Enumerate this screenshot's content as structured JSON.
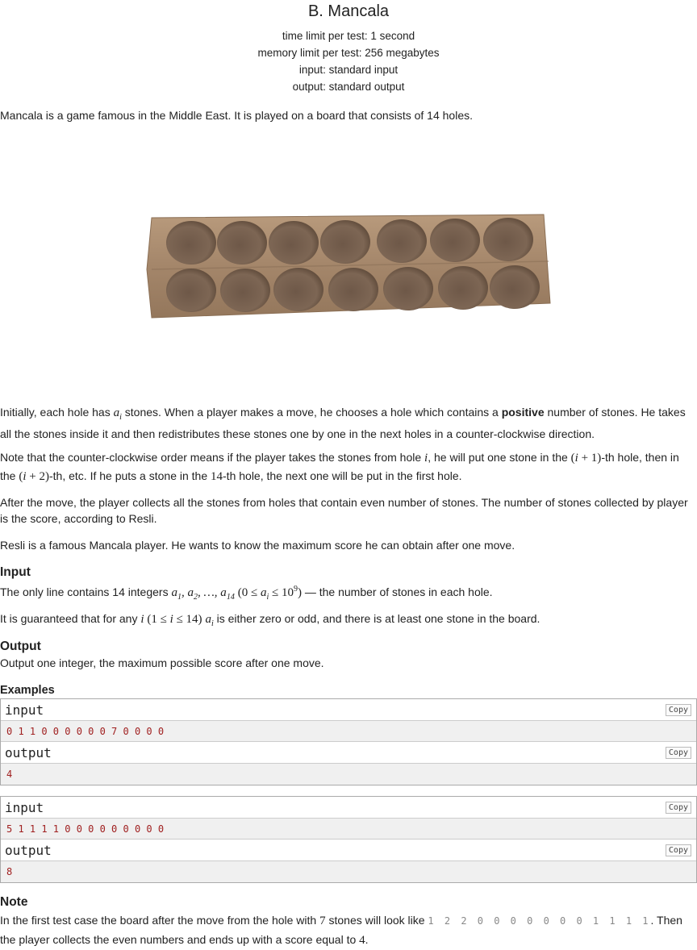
{
  "problem": {
    "title": "B. Mancala",
    "time_limit": "time limit per test: 1 second",
    "memory_limit": "memory limit per test: 256 megabytes",
    "input": "input: standard input",
    "output": "output: standard output"
  },
  "statement": {
    "intro": "Mancala is a game famous in the Middle East. It is played on a board that consists of 14 holes.",
    "p1_a": "Initially, each hole has ",
    "p1_b": " stones. When a player makes a move, he chooses a hole which contains a ",
    "p1_bold": "positive",
    "p1_c": " number of stones. He takes all the stones inside it and then redistributes these stones one by one in the next holes in a counter-clockwise direction.",
    "p2_a": "Note that the counter-clockwise order means if the player takes the stones from hole ",
    "p2_b": ", he will put one stone in the ",
    "p2_c": "-th hole, then in the ",
    "p2_d": "-th, etc. If he puts a stone in the ",
    "p2_e": "-th hole, the next one will be put in the first hole.",
    "p3": "After the move, the player collects all the stones from holes that contain even number of stones. The number of stones collected by player is the score, according to Resli.",
    "p4": "Resli is a famous Mancala player. He wants to know the maximum score he can obtain after one move."
  },
  "input_section": {
    "title": "Input",
    "l1_a": "The only line contains 14 integers ",
    "l1_b": " — the number of stones in each hole.",
    "l2_a": "It is guaranteed that for any ",
    "l2_b": " is either zero or odd, and there is at least one stone in the board."
  },
  "output_section": {
    "title": "Output",
    "text": "Output one integer, the maximum possible score after one move."
  },
  "examples": {
    "title": "Examples",
    "input_label": "input",
    "output_label": "output",
    "copy_label": "Copy",
    "tests": [
      {
        "input": "0 1 1 0 0 0 0 0 0 7 0 0 0 0",
        "output": "4"
      },
      {
        "input": "5 1 1 1 1 0 0 0 0 0 0 0 0 0",
        "output": "8"
      }
    ]
  },
  "note": {
    "title": "Note",
    "a": "In the first test case the board after the move from the hole with ",
    "b": " stones will look like ",
    "board": "1 2 2 0 0 0 0 0 0 0 1 1 1 1",
    "c": ". Then the player collects the even numbers and ends up with a score equal to ",
    "d": "."
  },
  "colors": {
    "sample_value": "#a02020",
    "board_wood": "#a4866a",
    "hole": "#7d6654"
  },
  "icons": {
    "board_image": "mancala-board"
  }
}
